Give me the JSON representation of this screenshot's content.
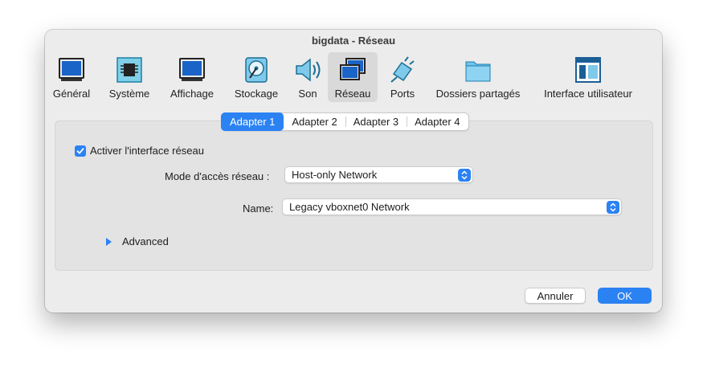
{
  "window": {
    "title": "bigdata - Réseau"
  },
  "toolbar": {
    "items": [
      {
        "label": "Général",
        "icon": "general-monitor-icon"
      },
      {
        "label": "Système",
        "icon": "system-chip-icon"
      },
      {
        "label": "Affichage",
        "icon": "display-monitor-icon"
      },
      {
        "label": "Stockage",
        "icon": "storage-disk-icon"
      },
      {
        "label": "Son",
        "icon": "speaker-icon"
      },
      {
        "label": "Réseau",
        "icon": "network-icon",
        "selected": true
      },
      {
        "label": "Ports",
        "icon": "ports-plug-icon"
      },
      {
        "label": "Dossiers partagés",
        "icon": "shared-folder-icon"
      },
      {
        "label": "Interface utilisateur",
        "icon": "user-interface-icon"
      }
    ]
  },
  "tabs": [
    {
      "label": "Adapter 1",
      "active": true
    },
    {
      "label": "Adapter 2"
    },
    {
      "label": "Adapter 3"
    },
    {
      "label": "Adapter 4"
    }
  ],
  "form": {
    "enable_label": "Activer l'interface réseau",
    "enable_checked": true,
    "mode_label": "Mode d'accès réseau :",
    "mode_value": "Host-only Network",
    "name_label": "Name:",
    "name_value": "Legacy vboxnet0 Network",
    "advanced_label": "Advanced"
  },
  "buttons": {
    "cancel": "Annuler",
    "ok": "OK"
  },
  "colors": {
    "accent": "#2b82f3",
    "window_bg": "#ececec"
  }
}
